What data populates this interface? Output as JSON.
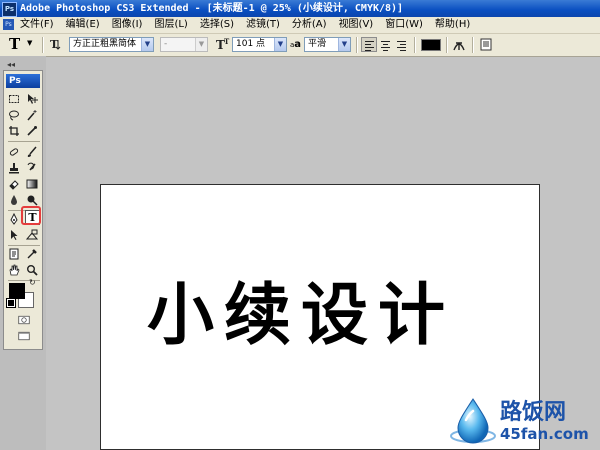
{
  "window": {
    "app_badge": "Ps",
    "title": "Adobe Photoshop CS3 Extended - [未标题-1 @ 25% (小续设计, CMYK/8)]"
  },
  "menu": {
    "items": [
      {
        "label": "文件(F)"
      },
      {
        "label": "编辑(E)"
      },
      {
        "label": "图像(I)"
      },
      {
        "label": "图层(L)"
      },
      {
        "label": "选择(S)"
      },
      {
        "label": "滤镜(T)"
      },
      {
        "label": "分析(A)"
      },
      {
        "label": "视图(V)"
      },
      {
        "label": "窗口(W)"
      },
      {
        "label": "帮助(H)"
      }
    ]
  },
  "options": {
    "tool_glyph": "T",
    "font_family": "方正正粗黑简体",
    "font_style": "-",
    "font_size": "101 点",
    "antialias_label": "a",
    "antialias_value": "平滑",
    "text_color": "#000000"
  },
  "tools": {
    "panel_badge": "Ps",
    "selected_tool": "type-tool",
    "selected_tool_glyph": "T",
    "highlight_color": "#e53d3d",
    "foreground_color": "#000000",
    "background_color": "#ffffff"
  },
  "canvas": {
    "text": "小续设计",
    "text_color": "#000000",
    "background": "#ffffff"
  },
  "watermark": {
    "title": "路饭网",
    "url": "45fan.com"
  }
}
